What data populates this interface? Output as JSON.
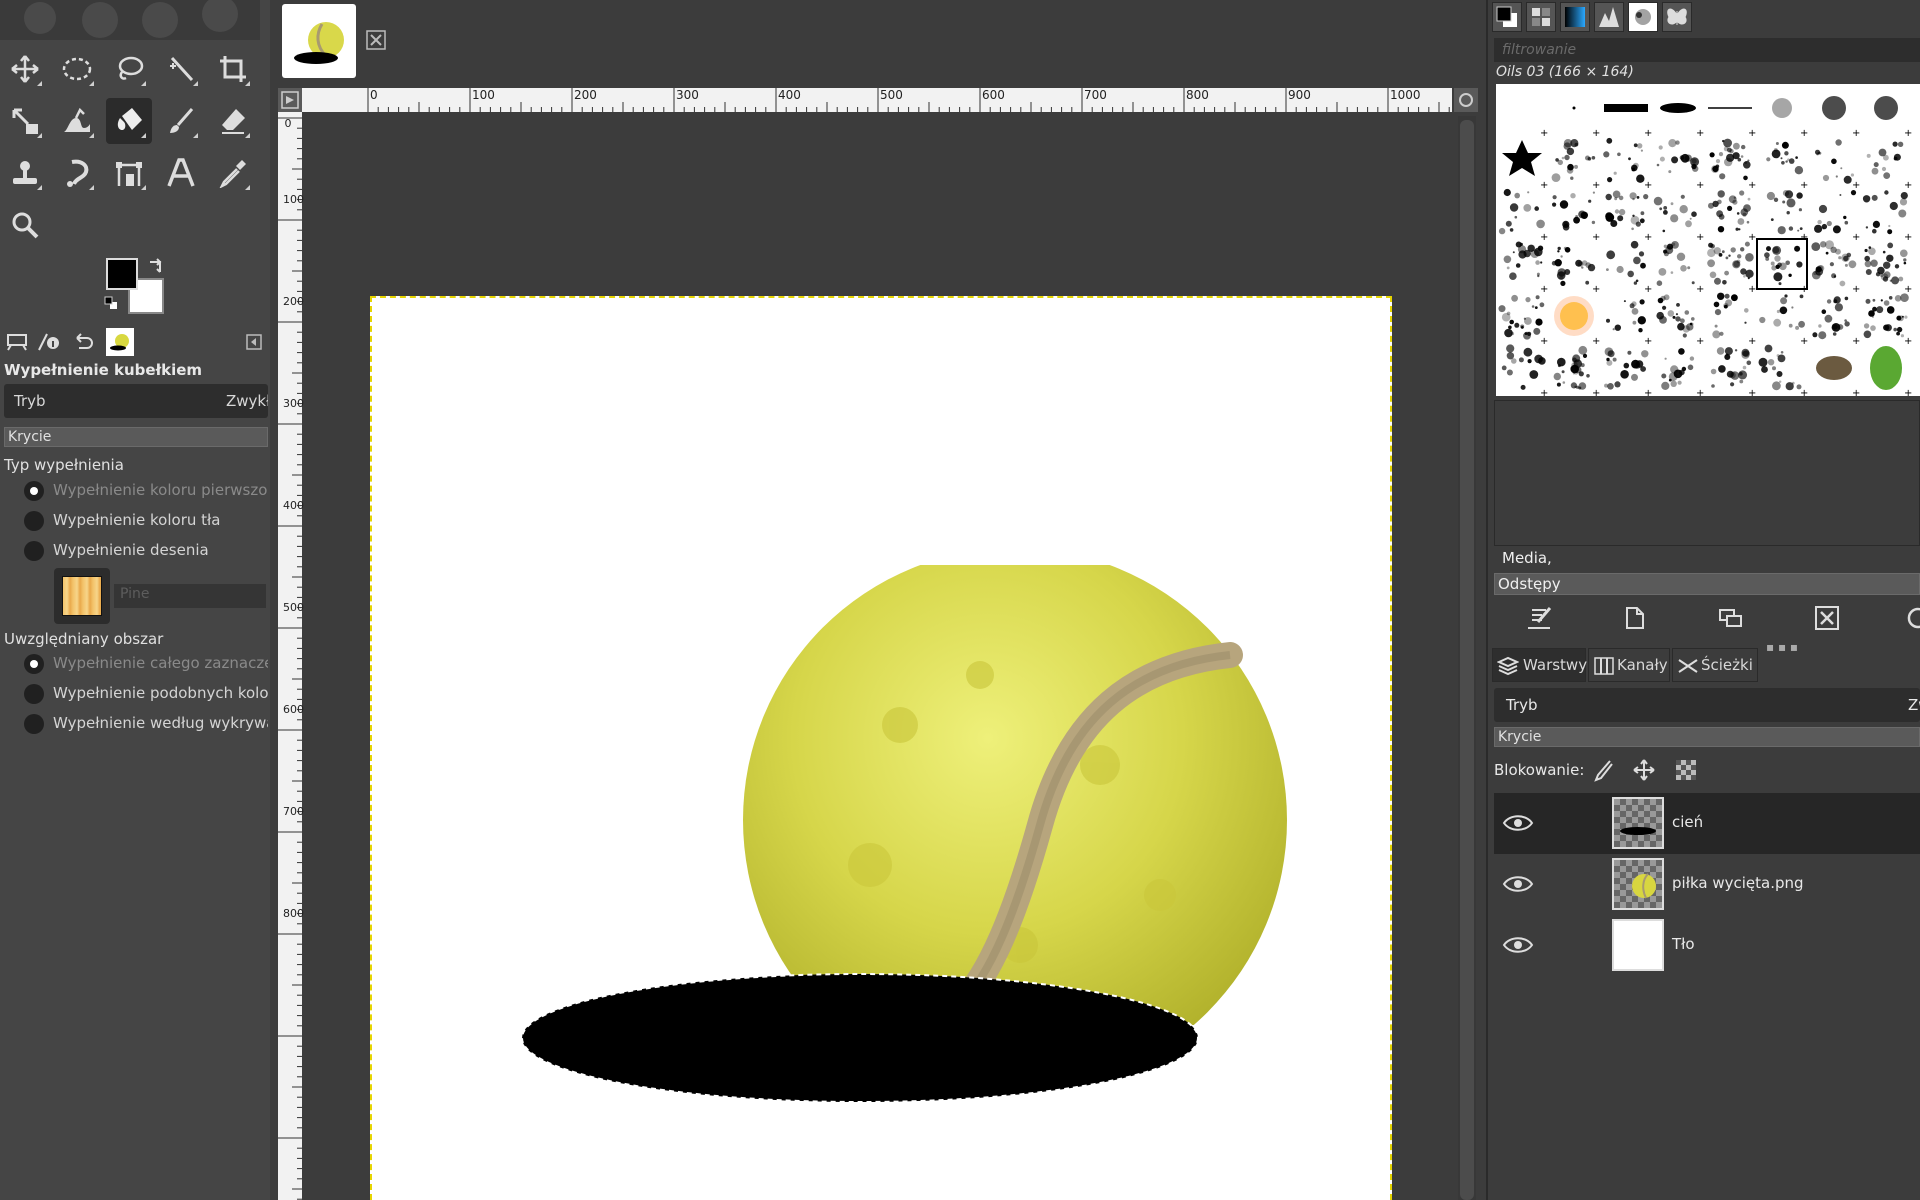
{
  "tool_options": {
    "title": "Wypełnienie kubełkiem",
    "mode_label": "Tryb",
    "mode_value": "Zwykłe",
    "opacity_label": "Krycie",
    "fill_type_label": "Typ wypełnienia",
    "fill_type_options": [
      "Wypełnienie koloru pierwszoplanowego",
      "Wypełnienie koloru tła",
      "Wypełnienie desenia"
    ],
    "fill_type_selected": 0,
    "pattern_name": "Pine",
    "area_label": "Uwzględniany obszar",
    "area_options": [
      "Wypełnienie całego zaznaczenia",
      "Wypełnienie podobnych kolorów",
      "Wypełnienie według wykrywania linii"
    ],
    "area_selected": 0
  },
  "toolbox": {
    "tools": [
      "move-tool",
      "ellipse-select-tool",
      "free-select-tool",
      "fuzzy-select-tool",
      "crop-tool",
      "scale-tool",
      "warp-tool",
      "bucket-fill-tool",
      "paintbrush-tool",
      "eraser-tool",
      "clone-tool",
      "smudge-tool",
      "paths-tool",
      "text-tool",
      "color-picker-tool",
      "zoom-tool"
    ],
    "active_tool": "bucket-fill-tool",
    "foreground_color": "#000000",
    "background_color": "#ffffff"
  },
  "ruler": {
    "h_labels": [
      "0",
      "100",
      "200",
      "300",
      "400",
      "500",
      "600",
      "700",
      "800",
      "900",
      "1000"
    ],
    "v_labels": [
      "0",
      "100",
      "200",
      "300",
      "400",
      "500",
      "600",
      "700",
      "800"
    ]
  },
  "brushes": {
    "filter_placeholder": "filtrowanie",
    "selected_brush": "Oils 03 (166 × 164)",
    "tags_value": "Media,",
    "spacing_label": "Odstępy"
  },
  "layers_dock": {
    "tabs": [
      "Warstwy",
      "Kanały",
      "Ścieżki"
    ],
    "active_tab": "Warstwy",
    "mode_label": "Tryb",
    "mode_value": "Zw",
    "opacity_label": "Krycie",
    "lock_label": "Blokowanie:",
    "layers": [
      {
        "name": "cień",
        "visible": true,
        "selected": true
      },
      {
        "name": "piłka wycięta.png",
        "visible": true,
        "selected": false
      },
      {
        "name": "Tło",
        "visible": true,
        "selected": false
      }
    ]
  }
}
